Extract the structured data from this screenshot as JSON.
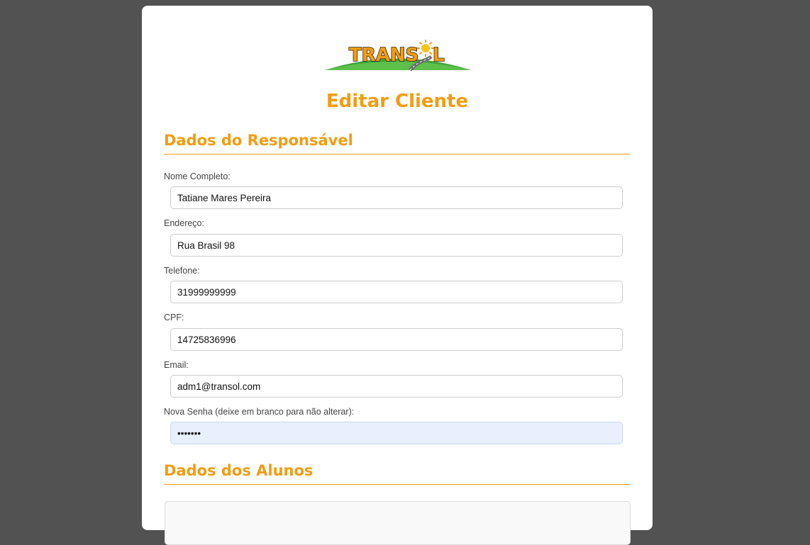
{
  "logo": {
    "text": "TRANSOL"
  },
  "page_title": "Editar Cliente",
  "sections": {
    "responsavel": "Dados do Responsável",
    "alunos": "Dados dos Alunos"
  },
  "form": {
    "nome": {
      "label": "Nome Completo:",
      "value": "Tatiane Mares Pereira"
    },
    "endereco": {
      "label": "Endereço:",
      "value": "Rua Brasil 98"
    },
    "telefone": {
      "label": "Telefone:",
      "value": "31999999999"
    },
    "cpf": {
      "label": "CPF:",
      "value": "14725836996"
    },
    "email": {
      "label": "Email:",
      "value": "adm1@transol.com"
    },
    "senha": {
      "label": "Nova Senha (deixe em branco para não alterar):",
      "value": "1234567"
    }
  },
  "colors": {
    "accent": "#f39c12",
    "background": "#525252",
    "card": "#ffffff",
    "autofill": "#e8f0fe"
  }
}
